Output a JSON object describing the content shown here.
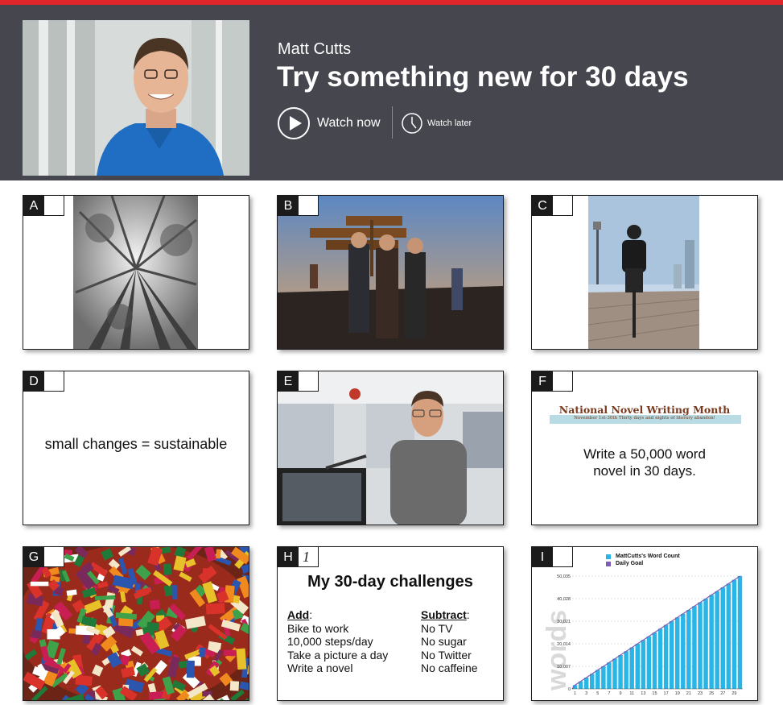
{
  "talk": {
    "speaker": "Matt Cutts",
    "title": "Try something new for 30 days",
    "watch_now_label": "Watch now",
    "watch_later_label": "Watch later"
  },
  "colors": {
    "accent": "#e0262b",
    "header_bg": "#46464f",
    "bar": "#29b6e6",
    "goal": "#7b5db3"
  },
  "slides": {
    "a": {
      "letter": "A"
    },
    "b": {
      "letter": "B"
    },
    "c": {
      "letter": "C"
    },
    "d": {
      "letter": "D",
      "text": "small changes = sustainable"
    },
    "e": {
      "letter": "E"
    },
    "f": {
      "letter": "F",
      "banner_title": "National Novel Writing Month",
      "banner_subtitle": "November 1st-30th   Thirty days and nights of literary abandon!",
      "line1": "Write a 50,000 word",
      "line2": "novel in 30 days."
    },
    "g": {
      "letter": "G"
    },
    "h": {
      "letter": "H",
      "number": "1",
      "title": "My 30-day challenges",
      "add_heading": "Add",
      "add_items": [
        "Bike to work",
        "10,000 steps/day",
        "Take a picture a day",
        "Write a novel"
      ],
      "subtract_heading": "Subtract",
      "subtract_items": [
        "No TV",
        "No sugar",
        "No Twitter",
        "No caffeine"
      ]
    },
    "i": {
      "letter": "I"
    }
  },
  "chart_data": {
    "type": "bar",
    "series": [
      {
        "name": "MattCutts's Word Count",
        "values": [
          1700,
          3300,
          5000,
          6700,
          8400,
          10000,
          11700,
          13400,
          15000,
          16700,
          18400,
          20000,
          21700,
          23300,
          25000,
          26700,
          28400,
          30000,
          31700,
          33300,
          35000,
          36700,
          38400,
          40000,
          41700,
          43300,
          45000,
          46700,
          48400,
          50100
        ]
      },
      {
        "name": "Daily Goal",
        "values": [
          1667,
          3333,
          5000,
          6667,
          8333,
          10000,
          11667,
          13333,
          15000,
          16667,
          18333,
          20000,
          21667,
          23333,
          25000,
          26667,
          28333,
          30000,
          31667,
          33333,
          35000,
          36667,
          38333,
          40000,
          41667,
          43333,
          45000,
          46667,
          48333,
          50000
        ]
      }
    ],
    "x_ticks": [
      "1",
      "3",
      "5",
      "7",
      "9",
      "11",
      "13",
      "15",
      "17",
      "19",
      "21",
      "23",
      "25",
      "27",
      "29"
    ],
    "y_ticks": [
      "0",
      "10,007",
      "20,014",
      "30,021",
      "40,028",
      "50,035"
    ],
    "ylim": [
      0,
      50035
    ],
    "legend": "top"
  }
}
